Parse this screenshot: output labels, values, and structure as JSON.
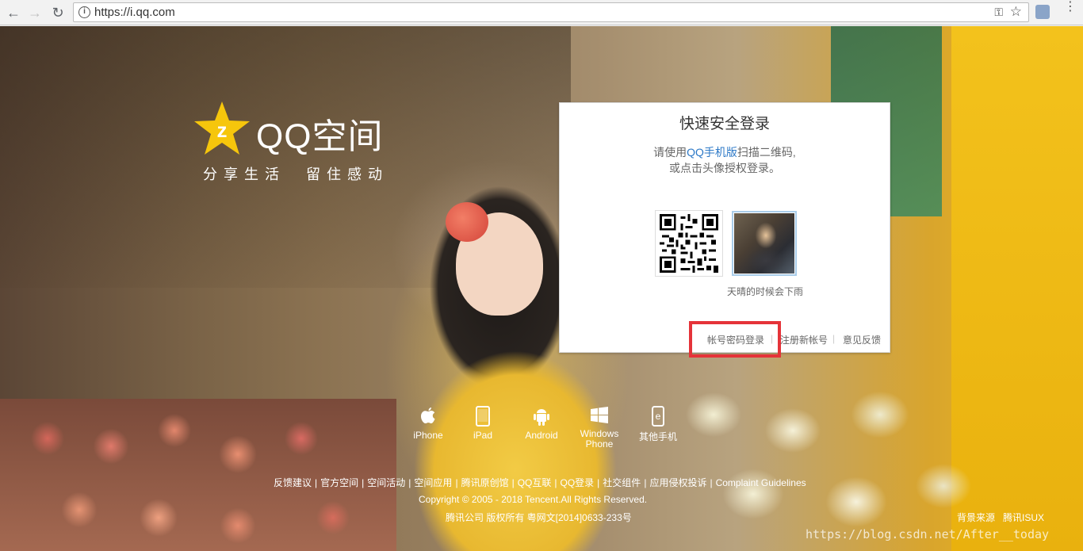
{
  "browser": {
    "url": "https://i.qq.com",
    "back_icon": "arrow-left-icon",
    "forward_icon": "arrow-right-icon",
    "reload_icon": "reload-icon",
    "info_glyph": "i",
    "key_glyph": "⚿",
    "star_glyph": "☆"
  },
  "logo": {
    "text": "QQ空间",
    "slogan": "分享生活　留住感动"
  },
  "login": {
    "title": "快速安全登录",
    "desc_prefix": "请使用",
    "desc_link": "QQ手机版",
    "desc_suffix": "扫描二维码,",
    "desc_line2": "或点击头像授权登录。",
    "avatar_name": "天晴的时候会下雨",
    "links": {
      "account_login": "帐号密码登录",
      "separator": "|",
      "register": "注册新帐号",
      "feedback": "意见反馈"
    },
    "highlight_color": "#e53339"
  },
  "clients": [
    {
      "label": "iPhone",
      "icon": "apple-icon",
      "glyph": ""
    },
    {
      "label": "iPad",
      "icon": "tablet-icon",
      "glyph": "▯"
    },
    {
      "label": "Android",
      "icon": "android-icon",
      "glyph": "🤖"
    },
    {
      "label": "Windows Phone",
      "icon": "windows-icon",
      "glyph": "⊞"
    },
    {
      "label": "其他手机",
      "icon": "other-phone-icon",
      "glyph": "ⓔ"
    }
  ],
  "footer": {
    "links": [
      "反馈建议",
      "官方空间",
      "空间活动",
      "空间应用",
      "腾讯原创馆",
      "QQ互联",
      "QQ登录",
      "社交组件",
      "应用侵权投诉",
      "Complaint Guidelines"
    ],
    "copyright": "Copyright © 2005 - 2018 Tencent.All Rights Reserved.",
    "icp": "腾讯公司 版权所有 粤网文[2014]0633-233号",
    "bg_source": "背景来源",
    "bg_credit": "腾讯ISUX",
    "watermark": "https://blog.csdn.net/After__today"
  }
}
